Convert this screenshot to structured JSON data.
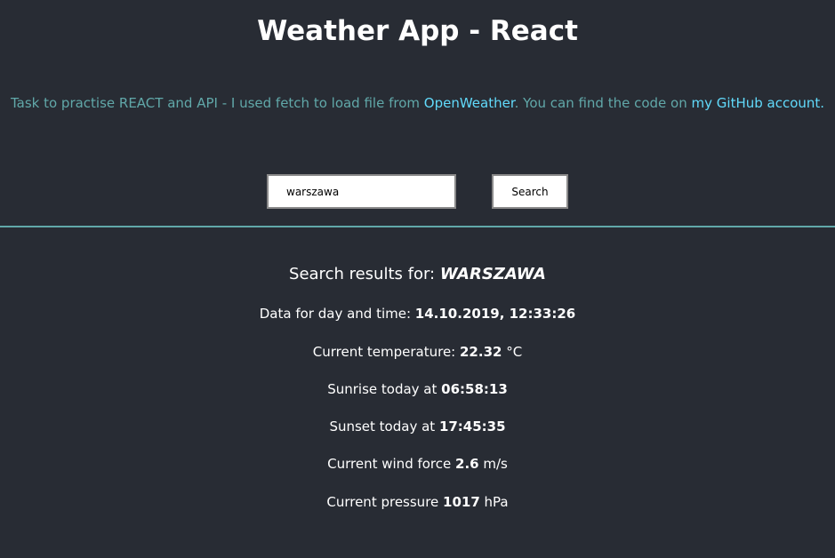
{
  "header": {
    "title": "Weather App - React"
  },
  "description": {
    "before_link1": "Task to practise REACT and API - I used fetch to load file from ",
    "link1": "OpenWeather",
    "between": ". You can find the code on ",
    "link2": "my GitHub account.",
    "after": ""
  },
  "search": {
    "input_value": "warszawa",
    "button_label": "Search"
  },
  "colors": {
    "background": "#282c34",
    "accent": "#61a8a9",
    "link": "#61dafb"
  },
  "results": {
    "heading_label": "Search results for: ",
    "city": "WARSZAWA",
    "date": {
      "label": "Data for day and time: ",
      "value": "14.10.2019, 12:33:26",
      "unit": ""
    },
    "temperature": {
      "label": "Current temperature: ",
      "value": "22.32",
      "unit": " °C"
    },
    "sunrise": {
      "label": "Sunrise today at ",
      "value": "06:58:13",
      "unit": ""
    },
    "sunset": {
      "label": "Sunset today at ",
      "value": "17:45:35",
      "unit": ""
    },
    "wind": {
      "label": "Current wind force ",
      "value": "2.6",
      "unit": " m/s"
    },
    "pressure": {
      "label": "Current pressure ",
      "value": "1017",
      "unit": " hPa"
    }
  }
}
